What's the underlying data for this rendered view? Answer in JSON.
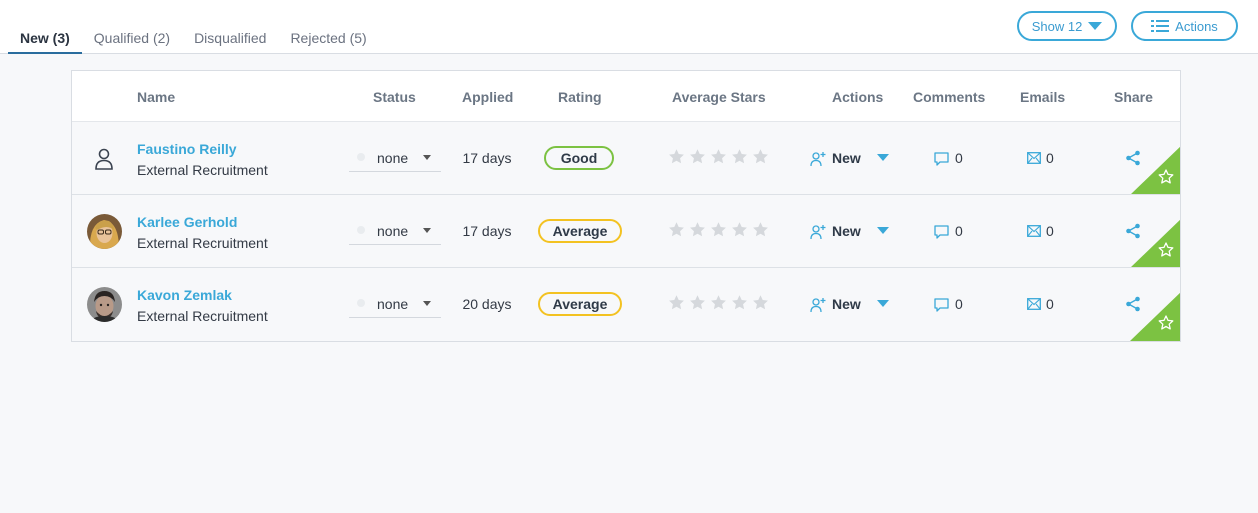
{
  "tabs": [
    {
      "label": "New (3)",
      "active": true
    },
    {
      "label": "Qualified (2)",
      "active": false
    },
    {
      "label": "Disqualified",
      "active": false
    },
    {
      "label": "Rejected (5)",
      "active": false
    }
  ],
  "toolbar": {
    "show_label": "Show 12",
    "actions_label": "Actions"
  },
  "columns": {
    "name": "Name",
    "status": "Status",
    "applied": "Applied",
    "rating": "Rating",
    "average_stars": "Average Stars",
    "actions": "Actions",
    "comments": "Comments",
    "emails": "Emails",
    "share": "Share"
  },
  "candidates": [
    {
      "name": "Faustino Reilly",
      "source": "External Recruitment",
      "status": "none",
      "applied": "17 days",
      "rating": "Good",
      "stars": 0,
      "action": "New",
      "comments": "0",
      "emails": "0",
      "avatar": "generic-user-icon"
    },
    {
      "name": "Karlee Gerhold",
      "source": "External Recruitment",
      "status": "none",
      "applied": "17 days",
      "rating": "Average",
      "stars": 0,
      "action": "New",
      "comments": "0",
      "emails": "0",
      "avatar": "photo"
    },
    {
      "name": "Kavon Zemlak",
      "source": "External Recruitment",
      "status": "none",
      "applied": "20 days",
      "rating": "Average",
      "stars": 0,
      "action": "New",
      "comments": "0",
      "emails": "0",
      "avatar": "photo"
    }
  ],
  "colors": {
    "accent": "#3aa8d8",
    "good": "#7cc242",
    "average": "#f3c221",
    "corner": "#7cc242"
  }
}
